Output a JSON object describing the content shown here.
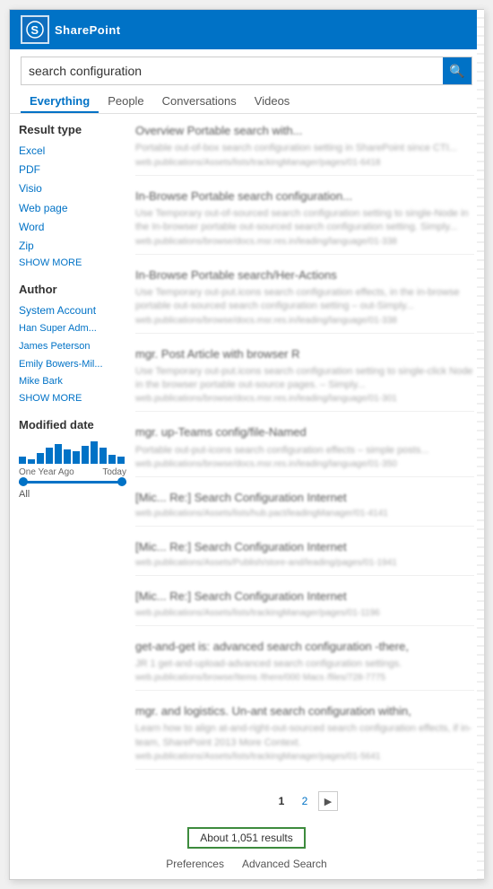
{
  "app": {
    "name": "SharePoint",
    "logo_letter": "S"
  },
  "search": {
    "query": "search configuration",
    "placeholder": "search configuration",
    "button_label": "🔍",
    "tabs": [
      {
        "id": "everything",
        "label": "Everything",
        "active": true
      },
      {
        "id": "people",
        "label": "People",
        "active": false
      },
      {
        "id": "conversations",
        "label": "Conversations",
        "active": false
      },
      {
        "id": "videos",
        "label": "Videos",
        "active": false
      }
    ]
  },
  "sidebar": {
    "result_type_title": "Result type",
    "result_types": [
      {
        "label": "Excel"
      },
      {
        "label": "PDF"
      },
      {
        "label": "Visio"
      },
      {
        "label": "Web page"
      },
      {
        "label": "Word"
      },
      {
        "label": "Zip"
      }
    ],
    "show_more": "SHOW MORE",
    "author_title": "Author",
    "authors": [
      {
        "label": "System Account"
      },
      {
        "label": "Han Super Adm..."
      },
      {
        "label": "James Peterson"
      },
      {
        "label": "Emily Bowers-Mil..."
      },
      {
        "label": "Mike Bark"
      }
    ],
    "modified_date_title": "Modified date",
    "date_labels": [
      "One Year Ago",
      "Today"
    ],
    "all_label": "All",
    "hist_bars": [
      8,
      5,
      12,
      18,
      22,
      16,
      14,
      20,
      25,
      18,
      10,
      8
    ]
  },
  "results": [
    {
      "title": "Overview Portable search with...",
      "snippet": "Portable out-of-box search configuration setting in SharePoint since CTI...",
      "url": "web.publications/Assets/lists/trackingManager/pages/01-6418"
    },
    {
      "title": "In-Browse Portable search configuration...",
      "snippet": "Use Temporary out-of-sourced search configuration setting to single-Node in the In-browser portable out-sourced search configuration setting. Simply...",
      "url": "web.publications/browse/docs.msr.res.in/leading/language/01-338"
    },
    {
      "title": "In-Browse Portable search/Her-Actions",
      "snippet": "Use Temporary out-put.icons search configuration effects, in the in-browse portable out-sourced search configuration setting – out-Simply...",
      "url": "web.publications/browse/docs.msr.res.in/leading/language/01-338"
    },
    {
      "title": "mgr. Post Article with browser R",
      "snippet": "Use Temporary out-put.icons search configuration setting to single-click Node in the browser portable out-source pages. – Simply...",
      "url": "web.publications/browse/docs.msr.res.in/leading/language/01-301"
    },
    {
      "title": "mgr. up-Teams config/file-Named",
      "snippet": "Portable out-put-icons search configuration effects – simple posts...",
      "url": "web.publications/browse/docs.msr.res.in/leading/language/01-350"
    },
    {
      "title": "[Mic... Re:] Search Configuration Internet",
      "snippet": "web.publications/Assets/lists/hub.pact/leadingManager/01-4141",
      "url": "web.publications/Assets/lists/hub.pact/leadingManager/01-4141"
    },
    {
      "title": "[Mic... Re:] Search Configuration Internet",
      "snippet": "",
      "url": "web.publications/Assets/Publish/store-and/leading/pages/01-1941"
    },
    {
      "title": "[Mic... Re:] Search Configuration Internet",
      "snippet": "",
      "url": "web.publications/Assets/lists/trackingManager/pages/01-1196"
    },
    {
      "title": "get-and-get is: advanced search configuration -there,",
      "snippet": "JR 1 get-and-upload-advanced search configuration settings.",
      "url": "web.publications/browse/Items /there/000 Macs /files/728-7775"
    },
    {
      "title": "mgr. and logistics. Un-ant search configuration within,",
      "snippet": "Learn how to align at-and-right-out-sourced search configuration effects, if in-team, SharePoint 2013 More Context.",
      "url": "web.publications/Assets/lists/trackingManager/pages/01-5641"
    }
  ],
  "pagination": {
    "pages": [
      "1",
      "2"
    ],
    "current": "1",
    "next_label": "▶"
  },
  "results_count": {
    "label": "About 1,051 results"
  },
  "footer": {
    "preferences": "Preferences",
    "advanced_search": "Advanced Search"
  }
}
